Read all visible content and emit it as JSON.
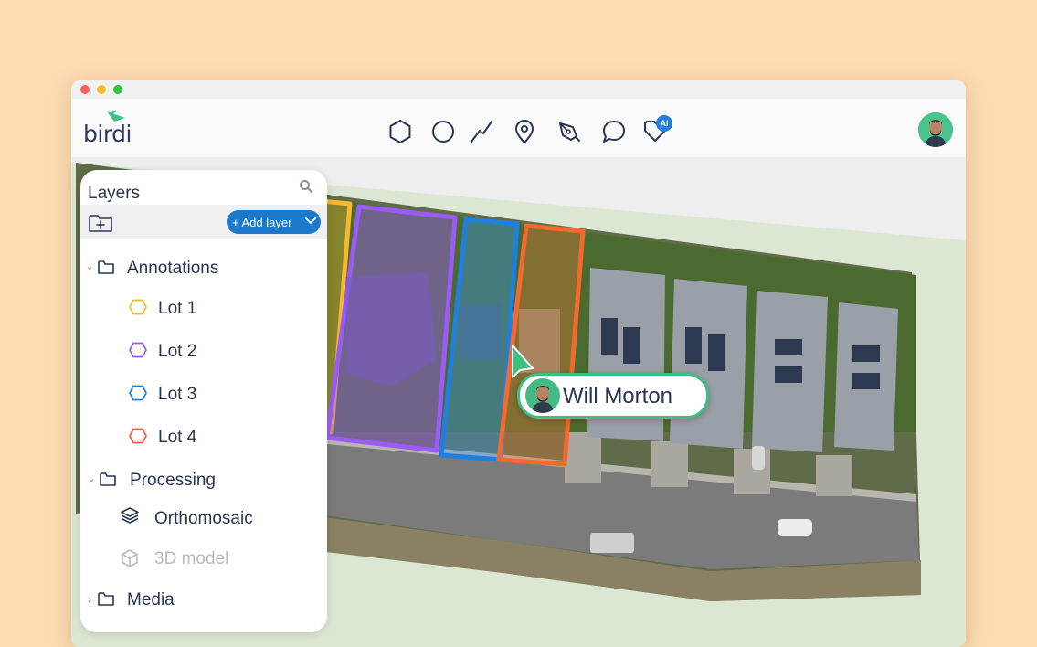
{
  "app": {
    "brand": "birdi"
  },
  "toolbar": {
    "tools": [
      {
        "icon": "polygon-icon"
      },
      {
        "icon": "circle-icon"
      },
      {
        "icon": "line-icon"
      },
      {
        "icon": "location-pin-icon"
      },
      {
        "icon": "pen-icon"
      },
      {
        "icon": "comment-icon"
      },
      {
        "icon": "ai-tag-icon",
        "badge": "AI"
      }
    ]
  },
  "user": {
    "avatar_color": "#4ac48a"
  },
  "layers_panel": {
    "title": "Layers",
    "add_layer_label": "+ Add layer",
    "annotations": {
      "label": "Annotations",
      "items": [
        {
          "label": "Lot 1",
          "color": "#f5b82e"
        },
        {
          "label": "Lot 2",
          "color": "#9b5cf6"
        },
        {
          "label": "Lot 3",
          "color": "#1f7fe0"
        },
        {
          "label": "Lot 4",
          "color": "#f05a4a"
        }
      ]
    },
    "processing": {
      "label": "Processing",
      "items": [
        {
          "label": "Orthomosaic",
          "icon": "layers-icon"
        },
        {
          "label": "3D model",
          "icon": "cube-icon",
          "disabled": true
        }
      ]
    },
    "media": {
      "label": "Media"
    }
  },
  "cursor_label": {
    "name": "Will Morton",
    "color": "#3fbf7f"
  },
  "colors": {
    "accent": "#1c78c9",
    "lot1": "#f5b82e",
    "lot2": "#9b5cf6",
    "lot3": "#1f7fe0",
    "lot4": "#f26a2e"
  }
}
